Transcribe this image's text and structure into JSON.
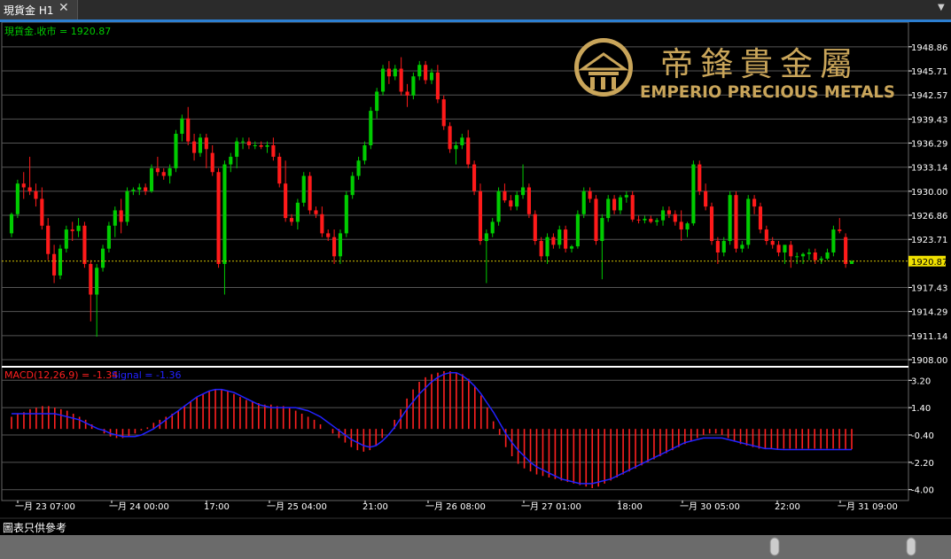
{
  "tab": {
    "title": "現貨金 H1",
    "close": "✕"
  },
  "footer": {
    "label": "圖表只供參考"
  },
  "logo": {
    "chinese": "帝鋒貴金屬",
    "english": "EMPERIO PRECIOUS METALS"
  },
  "colors": {
    "up": "#00cc00",
    "down": "#ff1a1a",
    "grid": "#555555",
    "axis_text": "#ffffff",
    "price_line": "#d4c200",
    "macd_hist": "#ff2020",
    "signal": "#2222ff",
    "accent": "#2c7fd2",
    "logo_gold": "#c9a55a"
  },
  "chart_data": [
    {
      "type": "candlestick",
      "title": "現貨金.收市 = 1920.87",
      "ylim": [
        1908.0,
        1951.5
      ],
      "y_ticks": [
        "1948.86",
        "1945.71",
        "1942.57",
        "1939.43",
        "1936.29",
        "1933.14",
        "1930.00",
        "1926.86",
        "1923.71",
        "1917.43",
        "1914.29",
        "1911.14",
        "1908.00"
      ],
      "last_price": "1920.87",
      "x_labels": [
        "一月 23 07:00",
        "一月 24 00:00",
        "17:00",
        "一月 25 04:00",
        "21:00",
        "一月 26 08:00",
        "一月 27 01:00",
        "18:00",
        "一月 30 05:00",
        "22:00",
        "一月 31 09:00"
      ],
      "ohlc": [
        [
          1924.5,
          1927.2,
          1924.0,
          1927.0
        ],
        [
          1927.0,
          1931.5,
          1926.5,
          1931.0
        ],
        [
          1931.0,
          1932.5,
          1929.0,
          1930.5
        ],
        [
          1930.5,
          1934.5,
          1929.5,
          1930.0
        ],
        [
          1930.0,
          1931.0,
          1928.0,
          1929.0
        ],
        [
          1929.0,
          1930.5,
          1925.0,
          1925.5
        ],
        [
          1925.5,
          1926.5,
          1921.0,
          1921.8
        ],
        [
          1921.8,
          1923.0,
          1918.0,
          1919.0
        ],
        [
          1919.0,
          1923.0,
          1918.5,
          1922.5
        ],
        [
          1922.5,
          1925.5,
          1922.0,
          1925.0
        ],
        [
          1925.0,
          1926.0,
          1923.5,
          1924.8
        ],
        [
          1924.8,
          1926.5,
          1924.0,
          1925.5
        ],
        [
          1925.5,
          1926.0,
          1920.0,
          1920.5
        ],
        [
          1920.5,
          1921.0,
          1913.0,
          1916.5
        ],
        [
          1916.5,
          1920.5,
          1911.0,
          1920.0
        ],
        [
          1920.0,
          1923.0,
          1919.5,
          1922.5
        ],
        [
          1922.5,
          1926.0,
          1922.0,
          1925.5
        ],
        [
          1925.5,
          1928.0,
          1924.0,
          1927.5
        ],
        [
          1927.5,
          1929.0,
          1924.5,
          1926.0
        ],
        [
          1926.0,
          1930.5,
          1925.5,
          1930.0
        ],
        [
          1930.0,
          1930.5,
          1929.5,
          1930.2
        ],
        [
          1930.2,
          1931.0,
          1929.5,
          1930.5
        ],
        [
          1930.5,
          1931.0,
          1929.5,
          1930.0
        ],
        [
          1930.0,
          1933.5,
          1929.8,
          1933.0
        ],
        [
          1933.0,
          1934.5,
          1932.0,
          1932.5
        ],
        [
          1932.5,
          1933.0,
          1931.5,
          1932.0
        ],
        [
          1932.0,
          1933.5,
          1931.0,
          1933.0
        ],
        [
          1933.0,
          1938.0,
          1932.5,
          1937.5
        ],
        [
          1937.5,
          1940.0,
          1936.5,
          1939.5
        ],
        [
          1939.5,
          1941.0,
          1936.0,
          1936.5
        ],
        [
          1936.5,
          1937.5,
          1934.0,
          1935.0
        ],
        [
          1935.0,
          1937.5,
          1934.5,
          1937.0
        ],
        [
          1937.0,
          1937.5,
          1933.0,
          1935.5
        ],
        [
          1935.0,
          1936.0,
          1932.0,
          1932.5
        ],
        [
          1932.5,
          1933.0,
          1920.0,
          1920.5
        ],
        [
          1920.5,
          1934.0,
          1916.5,
          1933.5
        ],
        [
          1933.5,
          1935.0,
          1932.5,
          1934.5
        ],
        [
          1934.5,
          1937.0,
          1933.0,
          1936.5
        ],
        [
          1936.5,
          1937.0,
          1935.5,
          1936.5
        ],
        [
          1936.5,
          1937.0,
          1935.5,
          1936.0
        ],
        [
          1936.0,
          1936.5,
          1935.5,
          1936.0
        ],
        [
          1936.0,
          1936.5,
          1935.5,
          1935.8
        ],
        [
          1935.8,
          1936.5,
          1935.0,
          1936.0
        ],
        [
          1936.0,
          1937.0,
          1934.0,
          1934.5
        ],
        [
          1934.5,
          1935.0,
          1930.5,
          1931.0
        ],
        [
          1931.0,
          1934.0,
          1926.0,
          1926.5
        ],
        [
          1926.5,
          1927.0,
          1925.5,
          1926.0
        ],
        [
          1926.0,
          1929.0,
          1925.0,
          1928.5
        ],
        [
          1928.5,
          1932.5,
          1928.0,
          1932.0
        ],
        [
          1932.0,
          1932.5,
          1927.0,
          1927.5
        ],
        [
          1927.5,
          1928.0,
          1926.5,
          1927.0
        ],
        [
          1927.0,
          1928.0,
          1924.0,
          1924.5
        ],
        [
          1924.5,
          1925.0,
          1923.5,
          1924.0
        ],
        [
          1924.0,
          1925.0,
          1920.5,
          1921.5
        ],
        [
          1921.5,
          1925.0,
          1920.5,
          1924.5
        ],
        [
          1924.5,
          1930.0,
          1924.0,
          1929.5
        ],
        [
          1929.5,
          1932.5,
          1929.0,
          1932.0
        ],
        [
          1932.0,
          1934.5,
          1931.5,
          1934.0
        ],
        [
          1934.0,
          1936.5,
          1933.5,
          1936.0
        ],
        [
          1936.0,
          1941.0,
          1935.5,
          1940.5
        ],
        [
          1940.5,
          1943.5,
          1939.5,
          1943.0
        ],
        [
          1943.0,
          1946.5,
          1942.5,
          1946.0
        ],
        [
          1946.0,
          1947.0,
          1944.0,
          1945.0
        ],
        [
          1945.0,
          1946.5,
          1944.5,
          1946.0
        ],
        [
          1946.0,
          1947.5,
          1942.5,
          1943.0
        ],
        [
          1943.0,
          1944.0,
          1941.0,
          1942.5
        ],
        [
          1942.5,
          1945.5,
          1942.0,
          1945.0
        ],
        [
          1945.0,
          1947.0,
          1944.5,
          1946.5
        ],
        [
          1946.5,
          1947.0,
          1944.0,
          1944.5
        ],
        [
          1944.5,
          1946.0,
          1944.0,
          1945.5
        ],
        [
          1945.5,
          1946.5,
          1941.5,
          1942.0
        ],
        [
          1942.0,
          1942.5,
          1938.0,
          1938.5
        ],
        [
          1938.5,
          1939.0,
          1935.0,
          1935.5
        ],
        [
          1935.5,
          1936.5,
          1933.5,
          1936.0
        ],
        [
          1936.0,
          1937.5,
          1935.5,
          1937.0
        ],
        [
          1937.0,
          1938.0,
          1933.0,
          1933.5
        ],
        [
          1933.5,
          1934.0,
          1929.5,
          1930.0
        ],
        [
          1930.0,
          1931.0,
          1923.0,
          1923.5
        ],
        [
          1923.5,
          1925.0,
          1918.0,
          1924.5
        ],
        [
          1924.5,
          1926.5,
          1924.0,
          1926.0
        ],
        [
          1926.0,
          1930.5,
          1925.5,
          1930.0
        ],
        [
          1930.0,
          1931.0,
          1928.5,
          1928.8
        ],
        [
          1928.8,
          1929.5,
          1927.5,
          1928.0
        ],
        [
          1928.0,
          1930.0,
          1927.5,
          1929.5
        ],
        [
          1929.5,
          1933.5,
          1929.0,
          1930.5
        ],
        [
          1930.5,
          1931.0,
          1926.5,
          1927.0
        ],
        [
          1927.0,
          1927.5,
          1923.0,
          1923.5
        ],
        [
          1923.5,
          1924.0,
          1921.0,
          1921.5
        ],
        [
          1921.5,
          1924.5,
          1920.5,
          1924.0
        ],
        [
          1924.0,
          1924.5,
          1922.5,
          1923.0
        ],
        [
          1923.0,
          1925.5,
          1922.5,
          1925.0
        ],
        [
          1925.0,
          1925.5,
          1922.0,
          1922.5
        ],
        [
          1922.5,
          1923.0,
          1922.0,
          1922.8
        ],
        [
          1922.8,
          1927.5,
          1922.5,
          1927.0
        ],
        [
          1927.0,
          1930.5,
          1926.5,
          1930.0
        ],
        [
          1930.0,
          1930.5,
          1928.5,
          1929.0
        ],
        [
          1929.0,
          1929.5,
          1923.0,
          1923.5
        ],
        [
          1923.5,
          1927.0,
          1918.5,
          1926.5
        ],
        [
          1926.5,
          1929.5,
          1926.0,
          1929.0
        ],
        [
          1929.0,
          1929.5,
          1927.0,
          1927.5
        ],
        [
          1927.5,
          1929.5,
          1927.0,
          1929.2
        ],
        [
          1929.2,
          1930.0,
          1928.5,
          1929.5
        ],
        [
          1929.5,
          1930.0,
          1926.0,
          1926.3
        ],
        [
          1926.3,
          1926.8,
          1925.8,
          1926.2
        ],
        [
          1926.2,
          1926.8,
          1925.8,
          1926.4
        ],
        [
          1926.4,
          1926.8,
          1925.8,
          1926.0
        ],
        [
          1926.0,
          1926.5,
          1925.5,
          1926.2
        ],
        [
          1926.2,
          1928.0,
          1925.5,
          1927.5
        ],
        [
          1927.5,
          1928.0,
          1926.5,
          1927.0
        ],
        [
          1927.0,
          1927.5,
          1925.5,
          1926.0
        ],
        [
          1926.0,
          1927.5,
          1923.5,
          1925.0
        ],
        [
          1925.0,
          1926.0,
          1924.0,
          1925.8
        ],
        [
          1925.8,
          1934.0,
          1925.5,
          1933.5
        ],
        [
          1933.5,
          1934.0,
          1929.5,
          1930.0
        ],
        [
          1930.0,
          1931.0,
          1927.5,
          1928.0
        ],
        [
          1928.0,
          1928.5,
          1923.0,
          1923.5
        ],
        [
          1923.5,
          1924.0,
          1920.5,
          1922.0
        ],
        [
          1922.0,
          1924.0,
          1921.5,
          1923.5
        ],
        [
          1923.5,
          1930.0,
          1923.0,
          1929.5
        ],
        [
          1929.5,
          1930.0,
          1922.0,
          1922.5
        ],
        [
          1922.5,
          1923.5,
          1922.0,
          1923.0
        ],
        [
          1923.0,
          1929.5,
          1922.5,
          1929.0
        ],
        [
          1929.0,
          1929.5,
          1927.0,
          1928.0
        ],
        [
          1928.0,
          1928.5,
          1924.5,
          1925.0
        ],
        [
          1925.0,
          1925.5,
          1923.0,
          1923.5
        ],
        [
          1923.5,
          1924.0,
          1922.5,
          1923.0
        ],
        [
          1923.0,
          1923.5,
          1921.5,
          1922.0
        ],
        [
          1922.0,
          1922.5,
          1920.5,
          1923.0
        ],
        [
          1923.0,
          1923.5,
          1920.0,
          1921.5
        ],
        [
          1921.5,
          1922.0,
          1920.5,
          1921.5
        ],
        [
          1921.5,
          1922.0,
          1920.5,
          1921.8
        ],
        [
          1921.8,
          1922.5,
          1921.0,
          1922.0
        ],
        [
          1922.0,
          1922.5,
          1920.5,
          1921.0
        ],
        [
          1921.0,
          1921.5,
          1920.5,
          1921.2
        ],
        [
          1921.2,
          1922.5,
          1921.0,
          1922.0
        ],
        [
          1922.0,
          1925.5,
          1921.5,
          1925.0
        ],
        [
          1925.0,
          1926.5,
          1924.5,
          1924.8
        ],
        [
          1924.0,
          1924.5,
          1920.0,
          1920.5
        ],
        [
          1920.5,
          1921.0,
          1920.5,
          1920.87
        ]
      ]
    },
    {
      "type": "bar",
      "title": "MACD(12,26,9) = -1.34",
      "signal_label": "Signal = -1.36",
      "ylim": [
        -4.6,
        3.8
      ],
      "y_ticks": [
        "3.20",
        "1.40",
        "-0.40",
        "-2.20",
        "-4.00"
      ],
      "macd": [
        0.8,
        1.0,
        1.1,
        1.3,
        1.4,
        1.5,
        1.5,
        1.4,
        1.3,
        1.2,
        1.0,
        0.8,
        0.6,
        0.3,
        0.0,
        -0.3,
        -0.5,
        -0.6,
        -0.6,
        -0.5,
        -0.3,
        -0.1,
        0.1,
        0.4,
        0.6,
        0.8,
        1.0,
        1.2,
        1.5,
        1.8,
        2.1,
        2.3,
        2.5,
        2.6,
        2.6,
        2.5,
        2.3,
        2.1,
        1.9,
        1.8,
        1.7,
        1.6,
        1.6,
        1.5,
        1.5,
        1.4,
        1.2,
        1.0,
        0.8,
        0.6,
        0.3,
        0.0,
        -0.3,
        -0.6,
        -0.9,
        -1.2,
        -1.4,
        -1.5,
        -1.4,
        -1.1,
        -0.6,
        0.0,
        0.6,
        1.3,
        2.0,
        2.6,
        3.1,
        3.4,
        3.6,
        3.7,
        3.8,
        3.8,
        3.7,
        3.6,
        3.3,
        2.8,
        2.2,
        1.4,
        0.5,
        -0.4,
        -1.2,
        -1.8,
        -2.3,
        -2.6,
        -2.8,
        -3.0,
        -3.1,
        -3.2,
        -3.3,
        -3.4,
        -3.5,
        -3.6,
        -3.7,
        -3.8,
        -3.9,
        -3.8,
        -3.6,
        -3.4,
        -3.2,
        -3.0,
        -2.8,
        -2.6,
        -2.4,
        -2.2,
        -2.0,
        -1.8,
        -1.6,
        -1.4,
        -1.2,
        -1.0,
        -0.8,
        -0.6,
        -0.4,
        -0.3,
        -0.3,
        -0.4,
        -0.6,
        -0.8,
        -1.0,
        -1.1,
        -1.2,
        -1.3,
        -1.3,
        -1.3,
        -1.3,
        -1.3,
        -1.3,
        -1.3,
        -1.3,
        -1.3,
        -1.3,
        -1.3,
        -1.3,
        -1.3,
        -1.3,
        -1.34,
        -1.34
      ],
      "signal": [
        1.0,
        1.0,
        1.0,
        1.0,
        1.0,
        1.0,
        1.0,
        1.0,
        0.9,
        0.8,
        0.7,
        0.6,
        0.4,
        0.2,
        0.0,
        -0.1,
        -0.3,
        -0.4,
        -0.5,
        -0.5,
        -0.5,
        -0.4,
        -0.2,
        0.0,
        0.3,
        0.6,
        0.9,
        1.2,
        1.5,
        1.8,
        2.1,
        2.3,
        2.5,
        2.6,
        2.6,
        2.5,
        2.4,
        2.2,
        2.0,
        1.8,
        1.6,
        1.5,
        1.4,
        1.4,
        1.4,
        1.4,
        1.4,
        1.3,
        1.2,
        1.0,
        0.8,
        0.5,
        0.2,
        -0.1,
        -0.4,
        -0.7,
        -0.9,
        -1.1,
        -1.2,
        -1.1,
        -0.8,
        -0.4,
        0.1,
        0.7,
        1.3,
        1.8,
        2.3,
        2.7,
        3.1,
        3.4,
        3.6,
        3.7,
        3.7,
        3.5,
        3.2,
        2.8,
        2.3,
        1.7,
        1.1,
        0.4,
        -0.3,
        -0.9,
        -1.4,
        -1.8,
        -2.2,
        -2.5,
        -2.7,
        -2.9,
        -3.1,
        -3.3,
        -3.4,
        -3.5,
        -3.6,
        -3.6,
        -3.6,
        -3.5,
        -3.4,
        -3.3,
        -3.1,
        -2.9,
        -2.7,
        -2.5,
        -2.3,
        -2.1,
        -1.9,
        -1.7,
        -1.5,
        -1.3,
        -1.1,
        -0.9,
        -0.8,
        -0.7,
        -0.6,
        -0.6,
        -0.6,
        -0.6,
        -0.7,
        -0.8,
        -0.9,
        -1.0,
        -1.1,
        -1.2,
        -1.3,
        -1.3,
        -1.35,
        -1.36,
        -1.36,
        -1.36,
        -1.36,
        -1.36,
        -1.36,
        -1.36,
        -1.36,
        -1.36,
        -1.36,
        -1.36,
        -1.36
      ]
    }
  ]
}
